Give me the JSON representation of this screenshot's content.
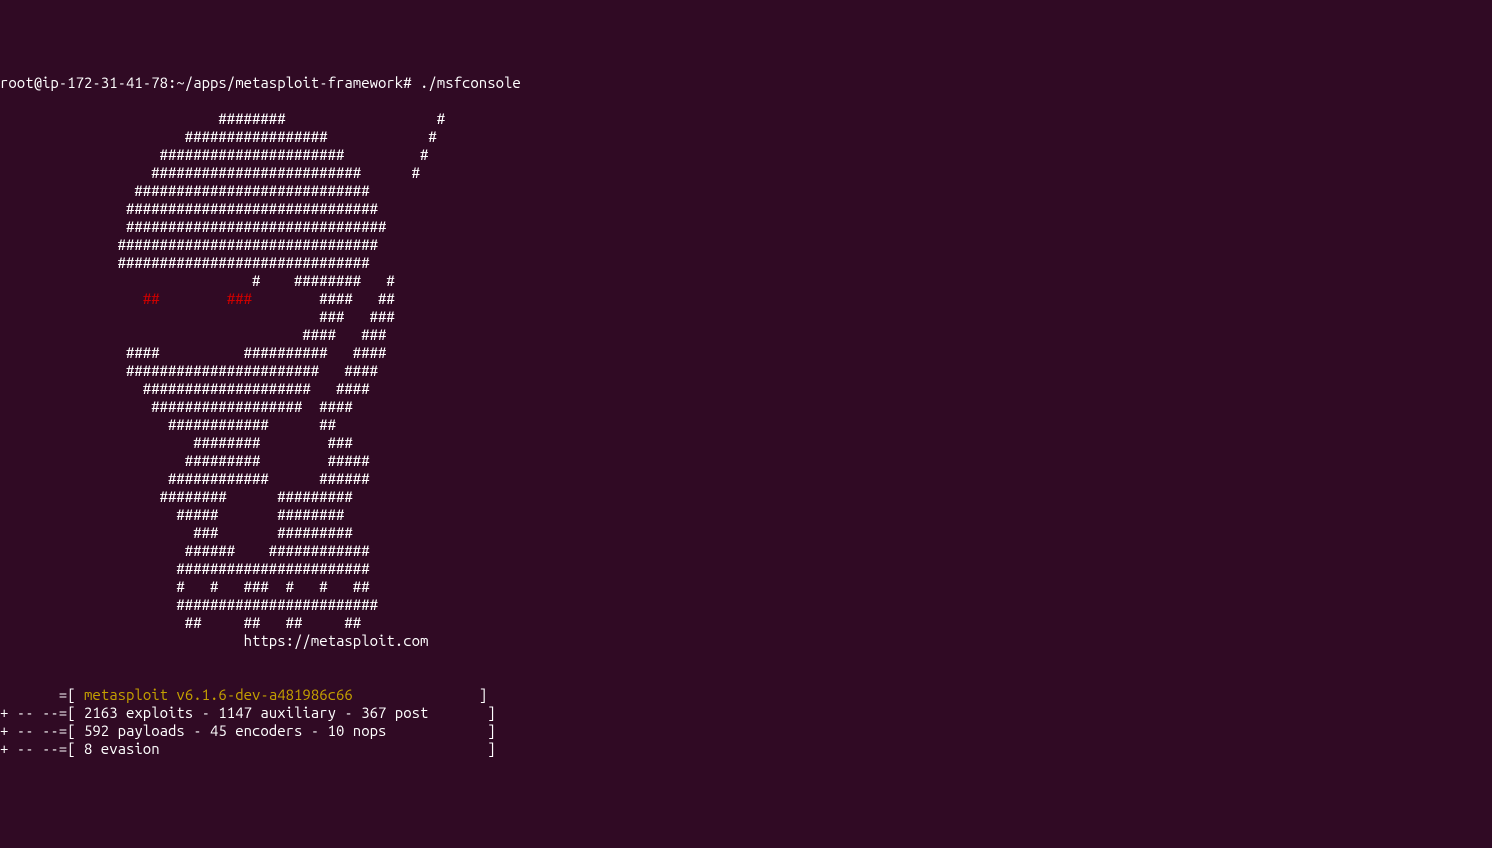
{
  "prompt": "root@ip-172-31-41-78:~/apps/metasploit-framework# ./msfconsole",
  "ascii": {
    "l01": "                          ########                  #",
    "l02": "                      #################            #",
    "l03": "                   ######################         #",
    "l04": "                  #########################      #",
    "l05": "                ############################",
    "l06": "               ##############################",
    "l07": "               ###############################",
    "l08": "              ###############################",
    "l09": "              ##############################",
    "l10": "                              #    ########   #",
    "l11a": "                 ",
    "l11b": "##",
    "l11c": "        ",
    "l11d": "###",
    "l11e": "        ####   ##",
    "l12": "                                      ###   ###",
    "l13": "                                    ####   ###",
    "l14": "               ####          ##########   ####",
    "l15": "               #######################   ####",
    "l16": "                 ####################   ####",
    "l17": "                  ##################  ####",
    "l18": "                    ############      ##",
    "l19": "                       ########        ###",
    "l20": "                      #########        #####",
    "l21": "                    ############      ######",
    "l22": "                   ########      #########",
    "l23": "                     #####       ########",
    "l24": "                       ###       #########",
    "l25": "                      ######    ############",
    "l26": "                     #######################",
    "l27": "                     #   #   ###  #   #   ##",
    "l28": "                     ########################",
    "l29": "                      ##     ##   ##     ##"
  },
  "url": "                             https://metasploit.com",
  "blank": "",
  "version": {
    "prefix": "       =[ ",
    "text": "metasploit v6.1.6-dev-a481986c66",
    "suffix": "               ]"
  },
  "stats": {
    "line1": "+ -- --=[ 2163 exploits - 1147 auxiliary - 367 post       ]",
    "line2": "+ -- --=[ 592 payloads - 45 encoders - 10 nops            ]",
    "line3": "+ -- --=[ 8 evasion                                       ]"
  }
}
